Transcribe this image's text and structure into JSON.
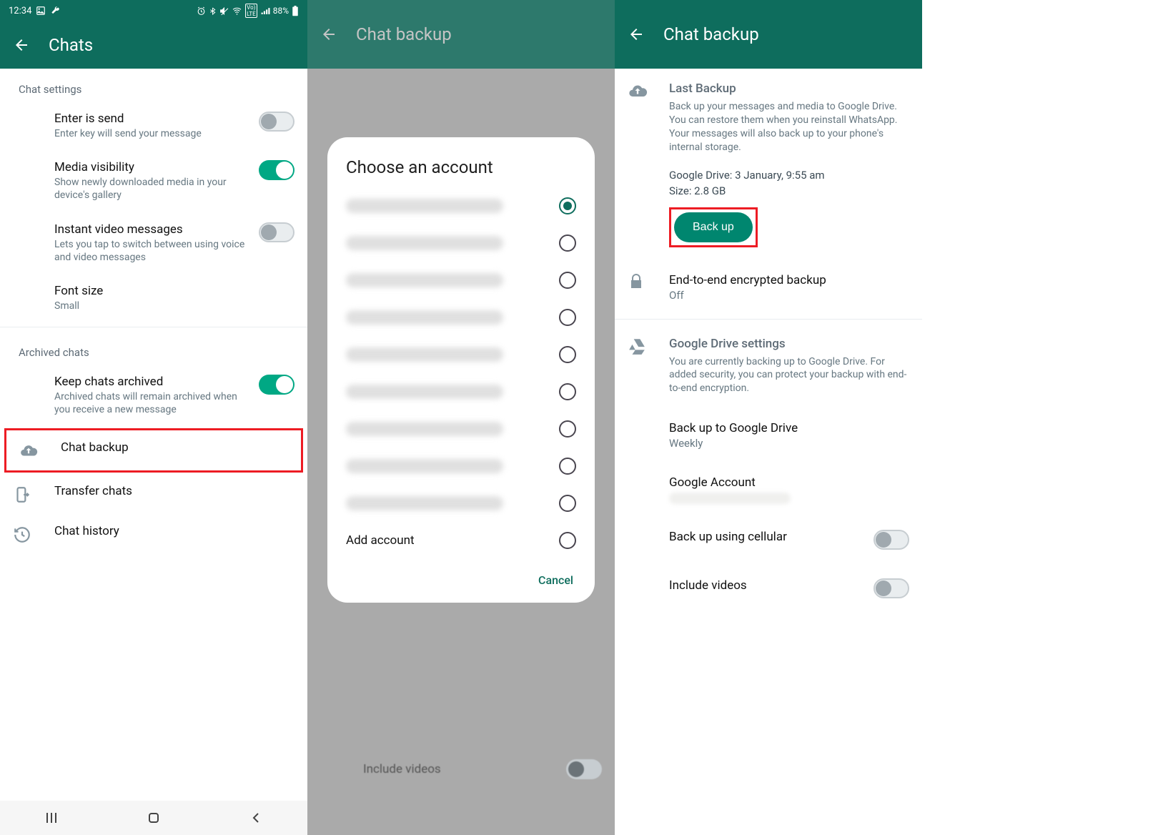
{
  "statusbar": {
    "time": "12:34",
    "battery": "88%"
  },
  "pane1": {
    "title": "Chats",
    "section1": "Chat settings",
    "enter_send": {
      "title": "Enter is send",
      "sub": "Enter key will send your message"
    },
    "media_vis": {
      "title": "Media visibility",
      "sub": "Show newly downloaded media in your device's gallery"
    },
    "instant_vid": {
      "title": "Instant video messages",
      "sub": "Lets you tap to switch between using voice and video messages"
    },
    "font_size": {
      "title": "Font size",
      "sub": "Small"
    },
    "section2": "Archived chats",
    "keep_archived": {
      "title": "Keep chats archived",
      "sub": "Archived chats will remain archived when you receive a new message"
    },
    "chat_backup": {
      "title": "Chat backup"
    },
    "transfer": {
      "title": "Transfer chats"
    },
    "history": {
      "title": "Chat history"
    }
  },
  "pane2": {
    "title": "Chat backup",
    "dialog_title": "Choose an account",
    "add_account": "Add account",
    "cancel": "Cancel",
    "bg_include_videos": "Include videos"
  },
  "pane3": {
    "title": "Chat backup",
    "last_backup": {
      "heading": "Last Backup",
      "desc": "Back up your messages and media to Google Drive. You can restore them when you reinstall WhatsApp. Your messages will also back up to your phone's internal storage.",
      "gdrive_line": "Google Drive: 3 January, 9:55 am",
      "size_line": "Size: 2.8 GB",
      "button": "Back up"
    },
    "e2e": {
      "title": "End-to-end encrypted backup",
      "sub": "Off"
    },
    "gdrive": {
      "heading": "Google Drive settings",
      "desc": "You are currently backing up to Google Drive. For added security, you can protect your backup with end-to-end encryption.",
      "frequency": {
        "title": "Back up to Google Drive",
        "sub": "Weekly"
      },
      "account": {
        "title": "Google Account"
      },
      "cellular": {
        "title": "Back up using cellular"
      },
      "videos": {
        "title": "Include videos"
      }
    }
  }
}
